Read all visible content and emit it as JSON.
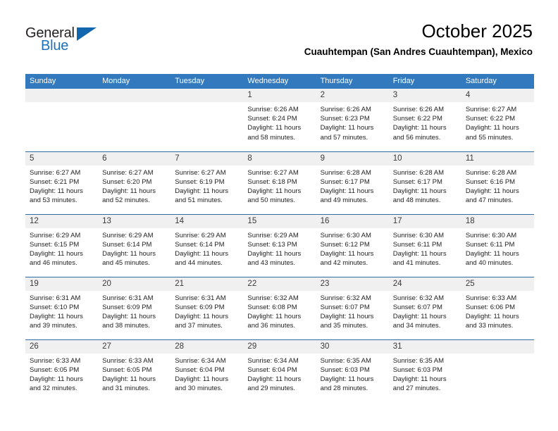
{
  "brand": {
    "name_top": "General",
    "name_bottom": "Blue",
    "accent_color": "#1166ae",
    "text_color": "#231f20"
  },
  "header": {
    "month_title": "October 2025",
    "location": "Cuauhtempan (San Andres Cuauhtempan), Mexico"
  },
  "calendar": {
    "header_background": "#3379bd",
    "header_text_color": "#ffffff",
    "date_band_background": "#f0f0f0",
    "week_separator_color": "#2e6da4",
    "weekdays": [
      "Sunday",
      "Monday",
      "Tuesday",
      "Wednesday",
      "Thursday",
      "Friday",
      "Saturday"
    ],
    "weeks": [
      [
        {
          "day": "",
          "sunrise": "",
          "sunset": "",
          "daylight_line1": "",
          "daylight_line2": "",
          "empty": true
        },
        {
          "day": "",
          "sunrise": "",
          "sunset": "",
          "daylight_line1": "",
          "daylight_line2": "",
          "empty": true
        },
        {
          "day": "",
          "sunrise": "",
          "sunset": "",
          "daylight_line1": "",
          "daylight_line2": "",
          "empty": true
        },
        {
          "day": "1",
          "sunrise": "Sunrise: 6:26 AM",
          "sunset": "Sunset: 6:24 PM",
          "daylight_line1": "Daylight: 11 hours",
          "daylight_line2": "and 58 minutes.",
          "empty": false
        },
        {
          "day": "2",
          "sunrise": "Sunrise: 6:26 AM",
          "sunset": "Sunset: 6:23 PM",
          "daylight_line1": "Daylight: 11 hours",
          "daylight_line2": "and 57 minutes.",
          "empty": false
        },
        {
          "day": "3",
          "sunrise": "Sunrise: 6:26 AM",
          "sunset": "Sunset: 6:22 PM",
          "daylight_line1": "Daylight: 11 hours",
          "daylight_line2": "and 56 minutes.",
          "empty": false
        },
        {
          "day": "4",
          "sunrise": "Sunrise: 6:27 AM",
          "sunset": "Sunset: 6:22 PM",
          "daylight_line1": "Daylight: 11 hours",
          "daylight_line2": "and 55 minutes.",
          "empty": false
        }
      ],
      [
        {
          "day": "5",
          "sunrise": "Sunrise: 6:27 AM",
          "sunset": "Sunset: 6:21 PM",
          "daylight_line1": "Daylight: 11 hours",
          "daylight_line2": "and 53 minutes.",
          "empty": false
        },
        {
          "day": "6",
          "sunrise": "Sunrise: 6:27 AM",
          "sunset": "Sunset: 6:20 PM",
          "daylight_line1": "Daylight: 11 hours",
          "daylight_line2": "and 52 minutes.",
          "empty": false
        },
        {
          "day": "7",
          "sunrise": "Sunrise: 6:27 AM",
          "sunset": "Sunset: 6:19 PM",
          "daylight_line1": "Daylight: 11 hours",
          "daylight_line2": "and 51 minutes.",
          "empty": false
        },
        {
          "day": "8",
          "sunrise": "Sunrise: 6:27 AM",
          "sunset": "Sunset: 6:18 PM",
          "daylight_line1": "Daylight: 11 hours",
          "daylight_line2": "and 50 minutes.",
          "empty": false
        },
        {
          "day": "9",
          "sunrise": "Sunrise: 6:28 AM",
          "sunset": "Sunset: 6:17 PM",
          "daylight_line1": "Daylight: 11 hours",
          "daylight_line2": "and 49 minutes.",
          "empty": false
        },
        {
          "day": "10",
          "sunrise": "Sunrise: 6:28 AM",
          "sunset": "Sunset: 6:17 PM",
          "daylight_line1": "Daylight: 11 hours",
          "daylight_line2": "and 48 minutes.",
          "empty": false
        },
        {
          "day": "11",
          "sunrise": "Sunrise: 6:28 AM",
          "sunset": "Sunset: 6:16 PM",
          "daylight_line1": "Daylight: 11 hours",
          "daylight_line2": "and 47 minutes.",
          "empty": false
        }
      ],
      [
        {
          "day": "12",
          "sunrise": "Sunrise: 6:29 AM",
          "sunset": "Sunset: 6:15 PM",
          "daylight_line1": "Daylight: 11 hours",
          "daylight_line2": "and 46 minutes.",
          "empty": false
        },
        {
          "day": "13",
          "sunrise": "Sunrise: 6:29 AM",
          "sunset": "Sunset: 6:14 PM",
          "daylight_line1": "Daylight: 11 hours",
          "daylight_line2": "and 45 minutes.",
          "empty": false
        },
        {
          "day": "14",
          "sunrise": "Sunrise: 6:29 AM",
          "sunset": "Sunset: 6:14 PM",
          "daylight_line1": "Daylight: 11 hours",
          "daylight_line2": "and 44 minutes.",
          "empty": false
        },
        {
          "day": "15",
          "sunrise": "Sunrise: 6:29 AM",
          "sunset": "Sunset: 6:13 PM",
          "daylight_line1": "Daylight: 11 hours",
          "daylight_line2": "and 43 minutes.",
          "empty": false
        },
        {
          "day": "16",
          "sunrise": "Sunrise: 6:30 AM",
          "sunset": "Sunset: 6:12 PM",
          "daylight_line1": "Daylight: 11 hours",
          "daylight_line2": "and 42 minutes.",
          "empty": false
        },
        {
          "day": "17",
          "sunrise": "Sunrise: 6:30 AM",
          "sunset": "Sunset: 6:11 PM",
          "daylight_line1": "Daylight: 11 hours",
          "daylight_line2": "and 41 minutes.",
          "empty": false
        },
        {
          "day": "18",
          "sunrise": "Sunrise: 6:30 AM",
          "sunset": "Sunset: 6:11 PM",
          "daylight_line1": "Daylight: 11 hours",
          "daylight_line2": "and 40 minutes.",
          "empty": false
        }
      ],
      [
        {
          "day": "19",
          "sunrise": "Sunrise: 6:31 AM",
          "sunset": "Sunset: 6:10 PM",
          "daylight_line1": "Daylight: 11 hours",
          "daylight_line2": "and 39 minutes.",
          "empty": false
        },
        {
          "day": "20",
          "sunrise": "Sunrise: 6:31 AM",
          "sunset": "Sunset: 6:09 PM",
          "daylight_line1": "Daylight: 11 hours",
          "daylight_line2": "and 38 minutes.",
          "empty": false
        },
        {
          "day": "21",
          "sunrise": "Sunrise: 6:31 AM",
          "sunset": "Sunset: 6:09 PM",
          "daylight_line1": "Daylight: 11 hours",
          "daylight_line2": "and 37 minutes.",
          "empty": false
        },
        {
          "day": "22",
          "sunrise": "Sunrise: 6:32 AM",
          "sunset": "Sunset: 6:08 PM",
          "daylight_line1": "Daylight: 11 hours",
          "daylight_line2": "and 36 minutes.",
          "empty": false
        },
        {
          "day": "23",
          "sunrise": "Sunrise: 6:32 AM",
          "sunset": "Sunset: 6:07 PM",
          "daylight_line1": "Daylight: 11 hours",
          "daylight_line2": "and 35 minutes.",
          "empty": false
        },
        {
          "day": "24",
          "sunrise": "Sunrise: 6:32 AM",
          "sunset": "Sunset: 6:07 PM",
          "daylight_line1": "Daylight: 11 hours",
          "daylight_line2": "and 34 minutes.",
          "empty": false
        },
        {
          "day": "25",
          "sunrise": "Sunrise: 6:33 AM",
          "sunset": "Sunset: 6:06 PM",
          "daylight_line1": "Daylight: 11 hours",
          "daylight_line2": "and 33 minutes.",
          "empty": false
        }
      ],
      [
        {
          "day": "26",
          "sunrise": "Sunrise: 6:33 AM",
          "sunset": "Sunset: 6:05 PM",
          "daylight_line1": "Daylight: 11 hours",
          "daylight_line2": "and 32 minutes.",
          "empty": false
        },
        {
          "day": "27",
          "sunrise": "Sunrise: 6:33 AM",
          "sunset": "Sunset: 6:05 PM",
          "daylight_line1": "Daylight: 11 hours",
          "daylight_line2": "and 31 minutes.",
          "empty": false
        },
        {
          "day": "28",
          "sunrise": "Sunrise: 6:34 AM",
          "sunset": "Sunset: 6:04 PM",
          "daylight_line1": "Daylight: 11 hours",
          "daylight_line2": "and 30 minutes.",
          "empty": false
        },
        {
          "day": "29",
          "sunrise": "Sunrise: 6:34 AM",
          "sunset": "Sunset: 6:04 PM",
          "daylight_line1": "Daylight: 11 hours",
          "daylight_line2": "and 29 minutes.",
          "empty": false
        },
        {
          "day": "30",
          "sunrise": "Sunrise: 6:35 AM",
          "sunset": "Sunset: 6:03 PM",
          "daylight_line1": "Daylight: 11 hours",
          "daylight_line2": "and 28 minutes.",
          "empty": false
        },
        {
          "day": "31",
          "sunrise": "Sunrise: 6:35 AM",
          "sunset": "Sunset: 6:03 PM",
          "daylight_line1": "Daylight: 11 hours",
          "daylight_line2": "and 27 minutes.",
          "empty": false
        },
        {
          "day": "",
          "sunrise": "",
          "sunset": "",
          "daylight_line1": "",
          "daylight_line2": "",
          "empty": true
        }
      ]
    ]
  }
}
